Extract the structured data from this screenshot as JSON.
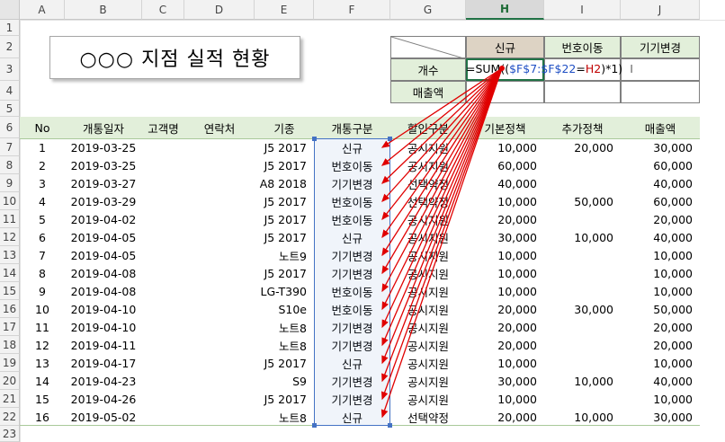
{
  "columns": [
    "A",
    "B",
    "C",
    "D",
    "E",
    "F",
    "G",
    "H",
    "I",
    "J"
  ],
  "rows": [
    "1",
    "2",
    "3",
    "4",
    "5",
    "6",
    "7",
    "8",
    "9",
    "10",
    "11",
    "12",
    "13",
    "14",
    "15",
    "16",
    "17",
    "18",
    "19",
    "20",
    "21",
    "22",
    "23"
  ],
  "title": "○○○ 지점  실적 현황",
  "summary": {
    "col_headers": [
      "신규",
      "번호이동",
      "기기변경"
    ],
    "row_headers": [
      "개수",
      "매출액"
    ],
    "formula_prefix": "=SUM((",
    "formula_range": "$F$7:$F$22",
    "formula_eq": "=",
    "formula_ref": "H2",
    "formula_suffix": ")*1)",
    "cursor": "I"
  },
  "table": {
    "headers": [
      "No",
      "개통일자",
      "고객명",
      "연락처",
      "기종",
      "개통구분",
      "할인구분",
      "기본정책",
      "추가정책",
      "매출액"
    ],
    "rows": [
      [
        "1",
        "2019-03-25",
        "",
        "",
        "J5 2017",
        "신규",
        "공시지원",
        "10,000",
        "20,000",
        "30,000"
      ],
      [
        "2",
        "2019-03-25",
        "",
        "",
        "J5 2017",
        "번호이동",
        "공시지원",
        "60,000",
        "",
        "60,000"
      ],
      [
        "3",
        "2019-03-27",
        "",
        "",
        "A8 2018",
        "기기변경",
        "선택약정",
        "40,000",
        "",
        "40,000"
      ],
      [
        "4",
        "2019-03-29",
        "",
        "",
        "J5 2017",
        "번호이동",
        "선택약정",
        "10,000",
        "50,000",
        "60,000"
      ],
      [
        "5",
        "2019-04-02",
        "",
        "",
        "J5 2017",
        "번호이동",
        "공시지원",
        "20,000",
        "",
        "20,000"
      ],
      [
        "6",
        "2019-04-05",
        "",
        "",
        "J5 2017",
        "신규",
        "공시지원",
        "30,000",
        "10,000",
        "40,000"
      ],
      [
        "7",
        "2019-04-05",
        "",
        "",
        "노트9",
        "기기변경",
        "공시지원",
        "10,000",
        "",
        "10,000"
      ],
      [
        "8",
        "2019-04-08",
        "",
        "",
        "J5 2017",
        "기기변경",
        "공시지원",
        "10,000",
        "",
        "10,000"
      ],
      [
        "9",
        "2019-04-08",
        "",
        "",
        "LG-T390",
        "번호이동",
        "공시지원",
        "10,000",
        "",
        "10,000"
      ],
      [
        "10",
        "2019-04-10",
        "",
        "",
        "S10e",
        "번호이동",
        "공시지원",
        "20,000",
        "30,000",
        "50,000"
      ],
      [
        "11",
        "2019-04-10",
        "",
        "",
        "노트8",
        "기기변경",
        "공시지원",
        "20,000",
        "",
        "20,000"
      ],
      [
        "12",
        "2019-04-11",
        "",
        "",
        "노트8",
        "기기변경",
        "공시지원",
        "20,000",
        "",
        "20,000"
      ],
      [
        "13",
        "2019-04-17",
        "",
        "",
        "J5 2017",
        "신규",
        "공시지원",
        "10,000",
        "",
        "10,000"
      ],
      [
        "14",
        "2019-04-23",
        "",
        "",
        "S9",
        "기기변경",
        "공시지원",
        "30,000",
        "10,000",
        "40,000"
      ],
      [
        "15",
        "2019-04-26",
        "",
        "",
        "J5 2017",
        "기기변경",
        "공시지원",
        "10,000",
        "",
        "10,000"
      ],
      [
        "16",
        "2019-05-02",
        "",
        "",
        "노트8",
        "신규",
        "선택약정",
        "20,000",
        "10,000",
        "30,000"
      ]
    ]
  },
  "colors": {
    "header_green": "#e2efda",
    "highlight_tan": "#ddd3c4",
    "range_blue": "#4472c4",
    "arrow_red": "#e00000"
  }
}
